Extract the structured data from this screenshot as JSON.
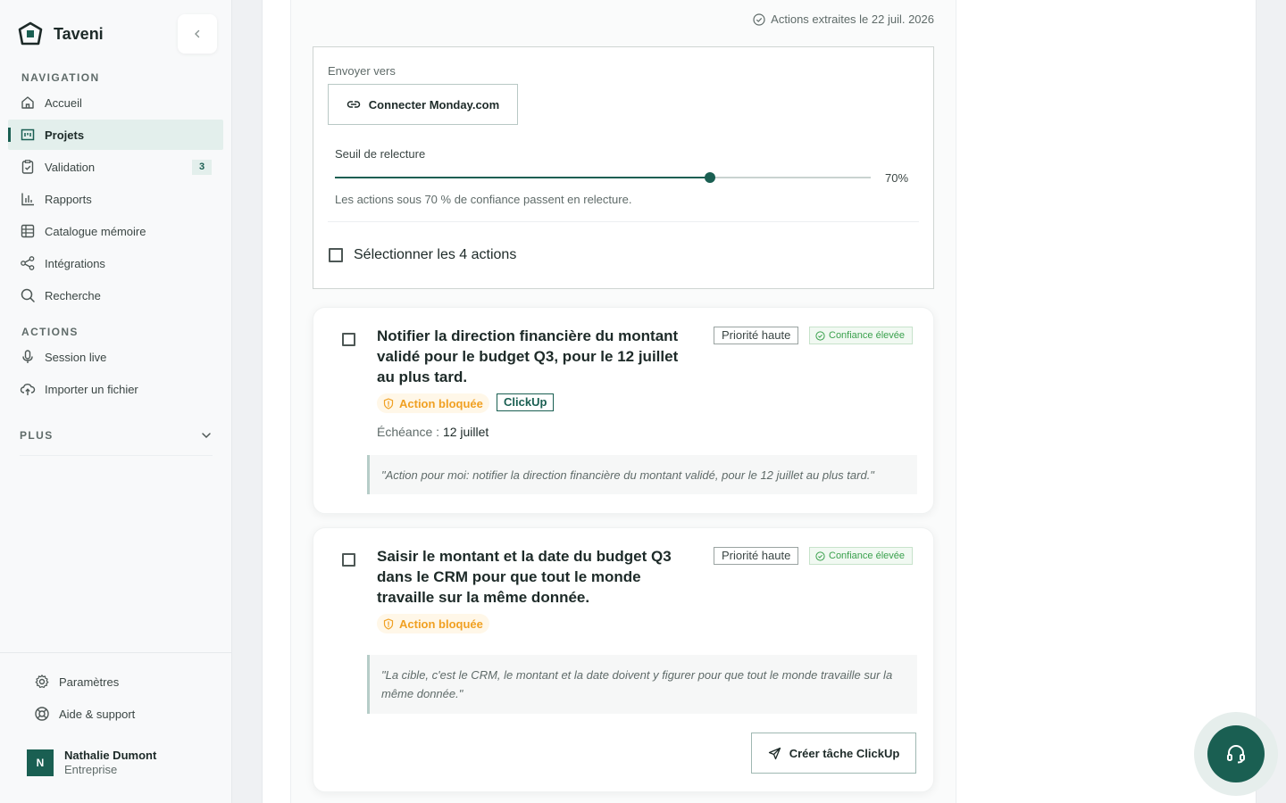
{
  "brand": {
    "name": "Taveni"
  },
  "sidebar": {
    "nav_label": "NAVIGATION",
    "nav_items": [
      {
        "label": "Accueil",
        "icon": "home-icon"
      },
      {
        "label": "Projets",
        "icon": "projects-icon",
        "active": true
      },
      {
        "label": "Validation",
        "icon": "clipboard-check-icon",
        "badge": "3"
      },
      {
        "label": "Rapports",
        "icon": "bar-chart-icon"
      },
      {
        "label": "Catalogue mémoire",
        "icon": "grid-table-icon"
      },
      {
        "label": "Intégrations",
        "icon": "share-nodes-icon"
      },
      {
        "label": "Recherche",
        "icon": "search-icon"
      }
    ],
    "actions_label": "ACTIONS",
    "action_items": [
      {
        "label": "Session live",
        "icon": "microphone-icon"
      },
      {
        "label": "Importer un fichier",
        "icon": "cloud-upload-icon"
      }
    ],
    "plus_label": "PLUS",
    "footer_items": [
      {
        "label": "Paramètres",
        "icon": "gear-icon"
      },
      {
        "label": "Aide & support",
        "icon": "lifebuoy-icon"
      }
    ],
    "user": {
      "initial": "N",
      "name": "Nathalie Dumont",
      "plan": "Entreprise"
    }
  },
  "main": {
    "extracted_text": "Actions extraites le 22 juil. 2026",
    "send_panel": {
      "send_label": "Envoyer vers",
      "connect_button": "Connecter Monday.com",
      "threshold_label": "Seuil de relecture",
      "threshold_value": 70,
      "threshold_display": "70%",
      "threshold_help": "Les actions sous 70 % de confiance passent en relecture.",
      "select_all_label": "Sélectionner les 4 actions"
    },
    "cards": [
      {
        "title": "Notifier la direction financière du montant validé pour le budget Q3, pour le 12 juillet au plus tard.",
        "priority": "Priorité haute",
        "confidence": "Confiance élevée",
        "status": "Action bloquée",
        "tool": "ClickUp",
        "due_label": "Échéance : ",
        "due_value": "12 juillet",
        "quote": "\"Action pour moi: notifier la direction financière du montant validé, pour le 12 juillet au plus tard.\""
      },
      {
        "title": "Saisir le montant et la date du budget Q3 dans le CRM pour que tout le monde travaille sur la même donnée.",
        "priority": "Priorité haute",
        "confidence": "Confiance élevée",
        "status": "Action bloquée",
        "quote": "\"La cible, c'est le CRM, le montant et la date doivent y figurer pour que tout le monde travaille sur la même donnée.\"",
        "create_button": "Créer tâche ClickUp"
      }
    ]
  },
  "colors": {
    "brand": "#1a5f52",
    "warning": "#f0a022",
    "success": "#3aa14d"
  }
}
